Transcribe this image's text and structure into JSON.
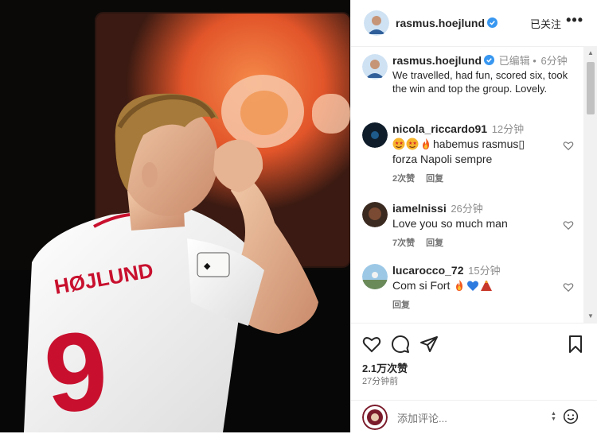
{
  "post": {
    "author": "rasmus.hoejlund",
    "follow_state": "已关注",
    "more_icon": "more-horizontal-icon",
    "jersey_name": "HØJLUND",
    "jersey_number": "9"
  },
  "caption": {
    "author": "rasmus.hoejlund",
    "edited": "已编辑 •",
    "time": "6分钟",
    "text": "We travelled, had fun, scored six, took the win and top the group. Lovely."
  },
  "comments": [
    {
      "user": "nicola_riccardo91",
      "time": "12分钟",
      "text": "habemus rasmus▯ forza Napoli sempre",
      "likes": "2次赞",
      "reply": "回复"
    },
    {
      "user": "iamelnissi",
      "time": "26分钟",
      "text": "Love you so much man",
      "likes": "7次赞",
      "reply": "回复"
    },
    {
      "user": "lucarocco_72",
      "time": "15分钟",
      "text": "Com si Fort",
      "likes": "",
      "reply": "回复"
    }
  ],
  "stats": {
    "likes": "2.1万次赞",
    "posted_ago": "27分钟前"
  },
  "add_comment": {
    "placeholder": "添加评论..."
  },
  "colors": {
    "verified": "#3897f0",
    "kit_red": "#c8102e",
    "shirt": "#f2f2f0"
  }
}
